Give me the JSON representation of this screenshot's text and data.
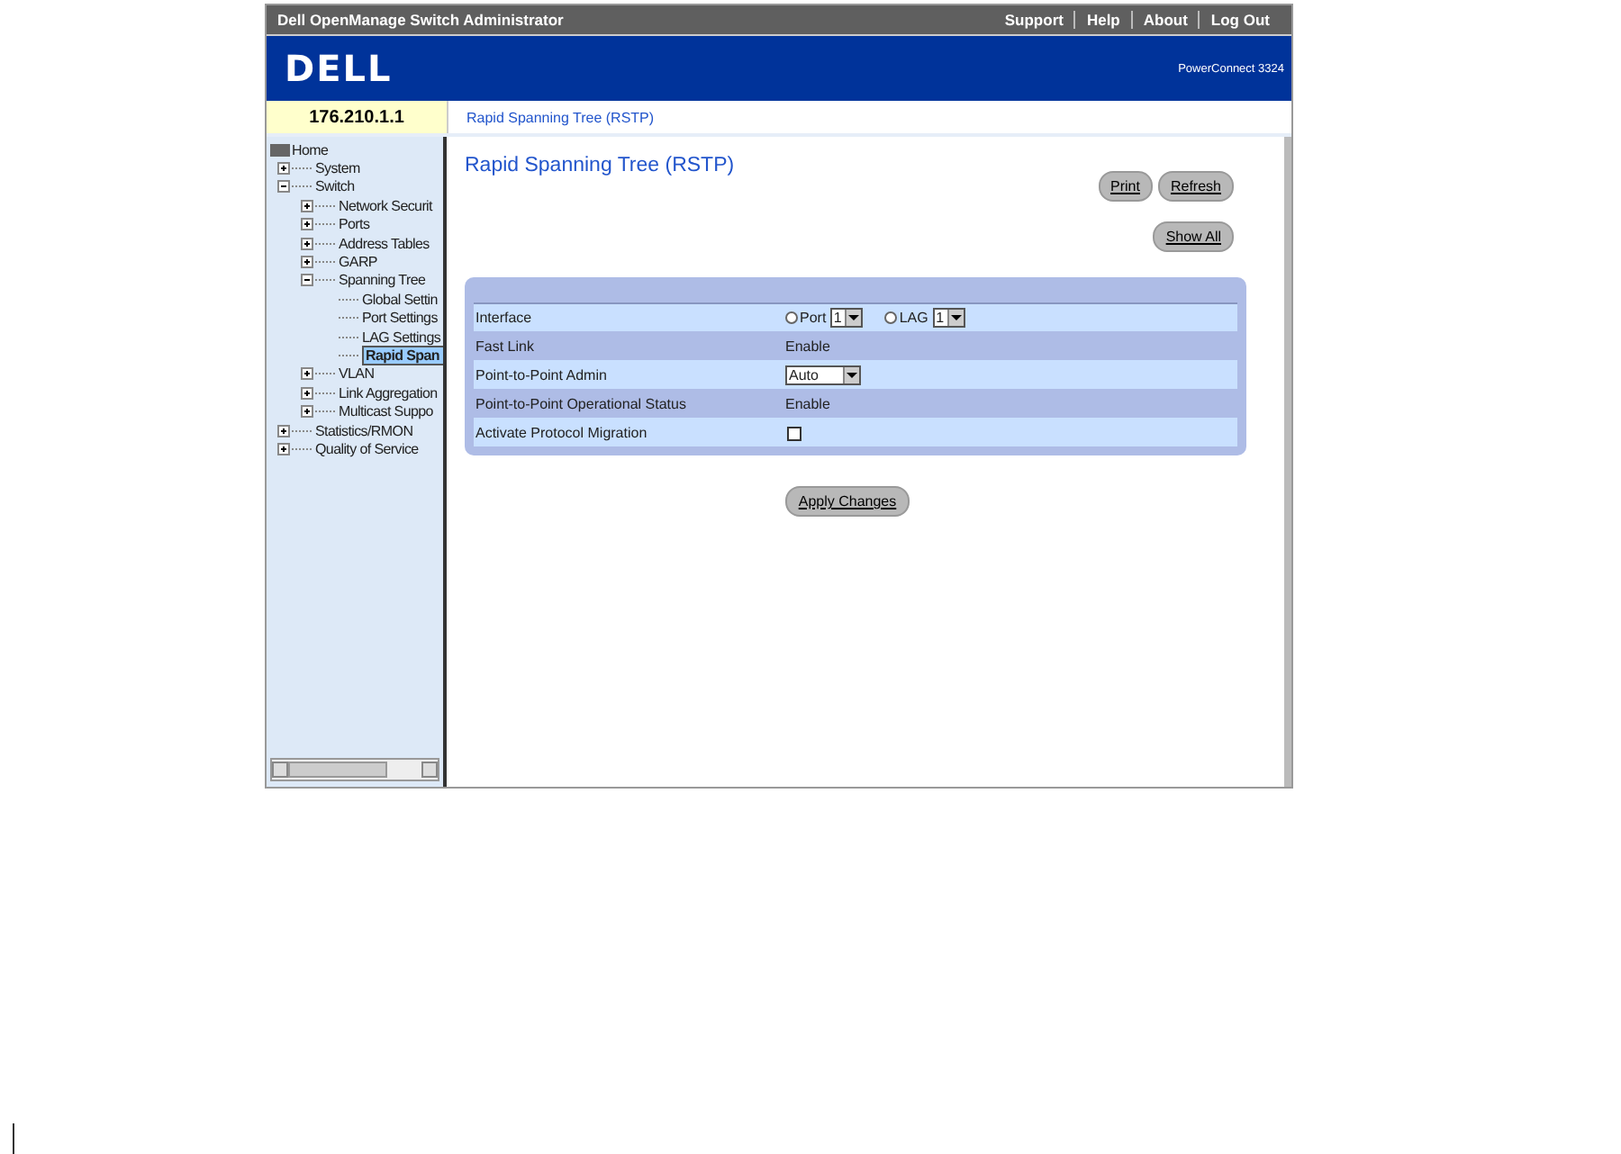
{
  "window": {
    "title": "Dell OpenManage Switch Administrator"
  },
  "header_links": [
    "Support",
    "Help",
    "About",
    "Log Out"
  ],
  "banner": {
    "logo": "DELL",
    "model": "PowerConnect 3324"
  },
  "device_ip": "176.210.1.1",
  "breadcrumb": "Rapid Spanning Tree (RSTP)",
  "sidebar": {
    "items": [
      {
        "label": "Home",
        "kind": "root",
        "selected": false,
        "children": [
          {
            "label": "System",
            "expanded": false,
            "selected": false
          },
          {
            "label": "Switch",
            "expanded": true,
            "selected": false,
            "children": [
              {
                "label": "Network Securit",
                "expanded": false,
                "selected": false
              },
              {
                "label": "Ports",
                "expanded": false,
                "selected": false
              },
              {
                "label": "Address Tables",
                "expanded": false,
                "selected": false
              },
              {
                "label": "GARP",
                "expanded": false,
                "selected": false
              },
              {
                "label": "Spanning Tree",
                "expanded": true,
                "selected": false,
                "children": [
                  {
                    "label": "Global Settin",
                    "selected": false
                  },
                  {
                    "label": "Port Settings",
                    "selected": false
                  },
                  {
                    "label": "LAG Settings",
                    "selected": false
                  },
                  {
                    "label": "Rapid Span",
                    "selected": true
                  }
                ]
              },
              {
                "label": "VLAN",
                "expanded": false,
                "selected": false
              },
              {
                "label": "Link Aggregation",
                "expanded": false,
                "selected": false
              },
              {
                "label": "Multicast Suppo",
                "expanded": false,
                "selected": false
              }
            ]
          },
          {
            "label": "Statistics/RMON",
            "expanded": false,
            "selected": false
          },
          {
            "label": "Quality of Service",
            "expanded": false,
            "selected": false
          }
        ]
      }
    ]
  },
  "page": {
    "title": "Rapid Spanning Tree (RSTP)",
    "top_buttons": [
      "Print",
      "Refresh"
    ],
    "show_all_button": "Show All",
    "form": [
      {
        "kind": "interface",
        "label": "Interface",
        "options": [
          {
            "label": "Port",
            "selected": false,
            "value": "1"
          },
          {
            "label": "LAG",
            "selected": false,
            "value": "1"
          }
        ]
      },
      {
        "kind": "text",
        "label": "Fast Link",
        "value": "Enable"
      },
      {
        "kind": "select",
        "label": "Point-to-Point Admin",
        "value": "Auto"
      },
      {
        "kind": "text",
        "label": "Point-to-Point Operational Status",
        "value": "Enable"
      },
      {
        "kind": "checkbox",
        "label": "Activate Protocol Migration",
        "checked": false
      }
    ],
    "apply_button": "Apply Changes"
  }
}
